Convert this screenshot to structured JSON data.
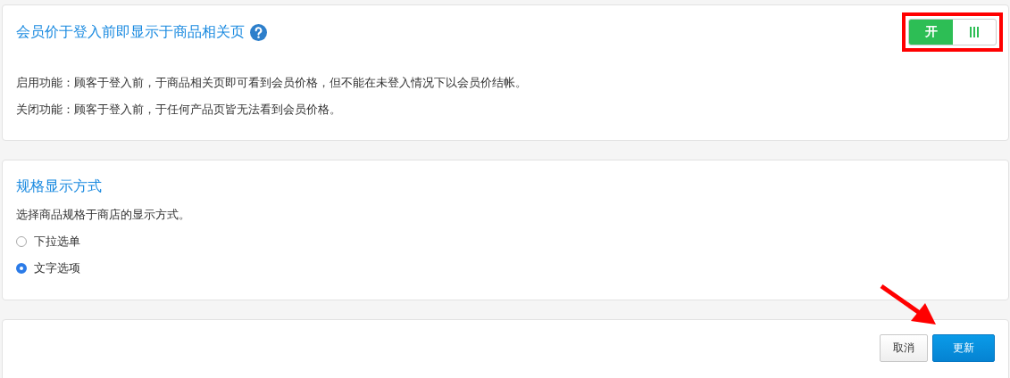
{
  "member_price_card": {
    "title": "会员价于登入前即显示于商品相关页",
    "toggle": {
      "on": true,
      "label": "开"
    },
    "descriptions": [
      "启用功能：顾客于登入前，于商品相关页即可看到会员价格，但不能在未登入情况下以会员价结帐。",
      "关闭功能：顾客于登入前，于任何产品页皆无法看到会员价格。"
    ]
  },
  "variant_card": {
    "title": "规格显示方式",
    "description": "选择商品规格于商店的显示方式。",
    "options": [
      {
        "label": "下拉选单",
        "selected": false
      },
      {
        "label": "文字选项",
        "selected": true
      }
    ]
  },
  "actions": {
    "buttons": [
      {
        "label": "取消",
        "kind": "secondary"
      },
      {
        "label": "更新",
        "kind": "primary"
      }
    ]
  }
}
